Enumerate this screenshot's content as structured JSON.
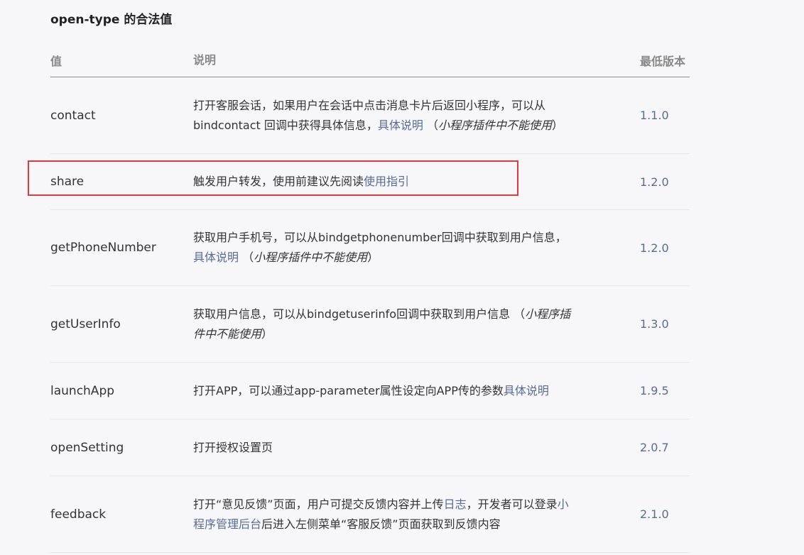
{
  "section": {
    "title": "open-type 的合法值"
  },
  "table": {
    "headers": {
      "value": "值",
      "description": "说明",
      "version": "最低版本"
    },
    "rows": [
      {
        "value": "contact",
        "desc": {
          "line1": "打开客服会话，如果用户在会话中点击消息卡片后返回小程序，可以从",
          "line2_text": "bindcontact 回调中获得具体信息，",
          "link": "具体说明",
          "note_open": " （",
          "note": "小程序插件中不能使用",
          "note_close": "）"
        },
        "version": "1.1.0"
      },
      {
        "value": "share",
        "desc": {
          "text": "触发用户转发，使用前建议先阅读",
          "link": "使用指引"
        },
        "version": "1.2.0"
      },
      {
        "value": "getPhoneNumber",
        "desc": {
          "line1": "获取用户手机号，可以从bindgetphonenumber回调中获取到用户信息，",
          "link": "具体说明",
          "note_open": " （",
          "note": "小程序插件中不能使用",
          "note_close": "）"
        },
        "version": "1.2.0"
      },
      {
        "value": "getUserInfo",
        "desc": {
          "line1_text": "获取用户信息，可以从bindgetuserinfo回调中获取到用户信息 （",
          "note_a": "小程序插",
          "note_b": "件中不能使用",
          "note_close": "）"
        },
        "version": "1.3.0"
      },
      {
        "value": "launchApp",
        "desc": {
          "text": "打开APP，可以通过app-parameter属性设定向APP传的参数",
          "link": "具体说明"
        },
        "version": "1.9.5"
      },
      {
        "value": "openSetting",
        "desc": {
          "text": "打开授权设置页"
        },
        "version": "2.0.7"
      },
      {
        "value": "feedback",
        "desc": {
          "text1": "打开“意见反馈”页面，用户可提交反馈内容并上传",
          "link1": "日志",
          "text2": "，开发者可以登录",
          "link2a": "小",
          "link2b": "程序管理后台",
          "text3": "后进入左侧菜单“客服反馈”页面获取到反馈内容"
        },
        "version": "2.1.0"
      }
    ]
  },
  "annotation": {
    "color": "#e03a3a"
  },
  "colors": {
    "link": "#576b95",
    "text": "#333333",
    "header": "#888888",
    "background": "#f7f7f9"
  }
}
